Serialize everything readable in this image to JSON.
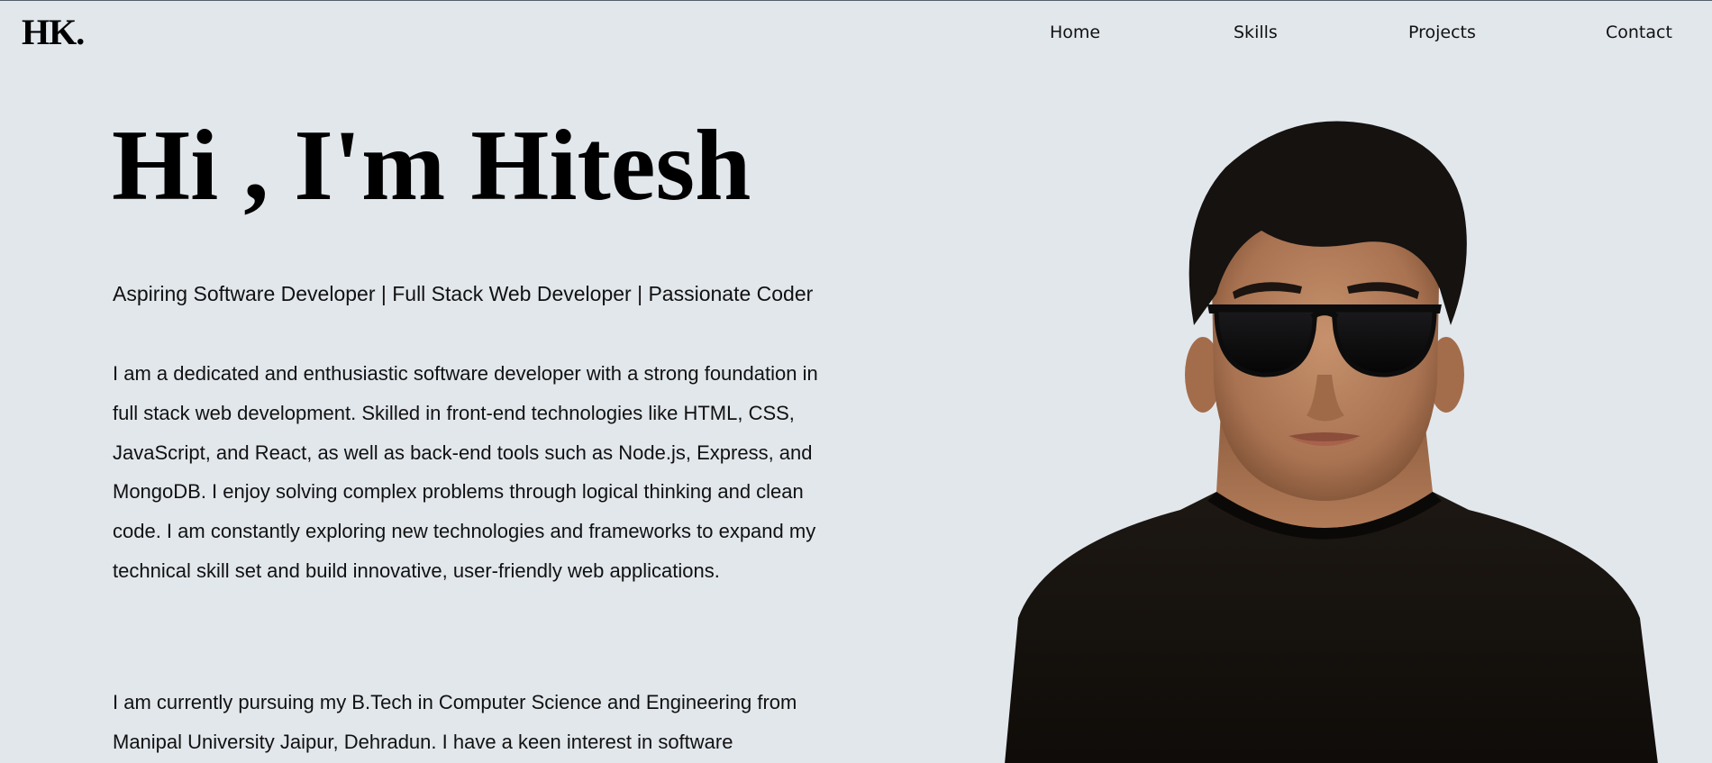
{
  "brand": {
    "logo": "HK."
  },
  "nav": {
    "items": [
      {
        "label": "Home"
      },
      {
        "label": "Skills"
      },
      {
        "label": "Projects"
      },
      {
        "label": "Contact"
      }
    ]
  },
  "hero": {
    "title": "Hi , I'm Hitesh",
    "tagline": "Aspiring Software Developer | Full Stack Web Developer | Passionate Coder",
    "paragraphs": [
      "I am a dedicated and enthusiastic software developer with a strong foundation in full stack web development. Skilled in front-end technologies like HTML, CSS, JavaScript, and React, as well as back-end tools such as Node.js, Express, and MongoDB. I enjoy solving complex problems through logical thinking and clean code. I am constantly exploring new technologies and frameworks to expand my technical skill set and build innovative, user-friendly web applications.",
      "I am currently pursuing my B.Tech in Computer Science and Engineering from Manipal University Jaipur, Dehradun. I have a keen interest in software"
    ]
  },
  "colors": {
    "background": "#e2e7ec",
    "text": "#0a0a0a",
    "shirt": "#15110d",
    "skin": "#b88462",
    "hair": "#151210"
  }
}
